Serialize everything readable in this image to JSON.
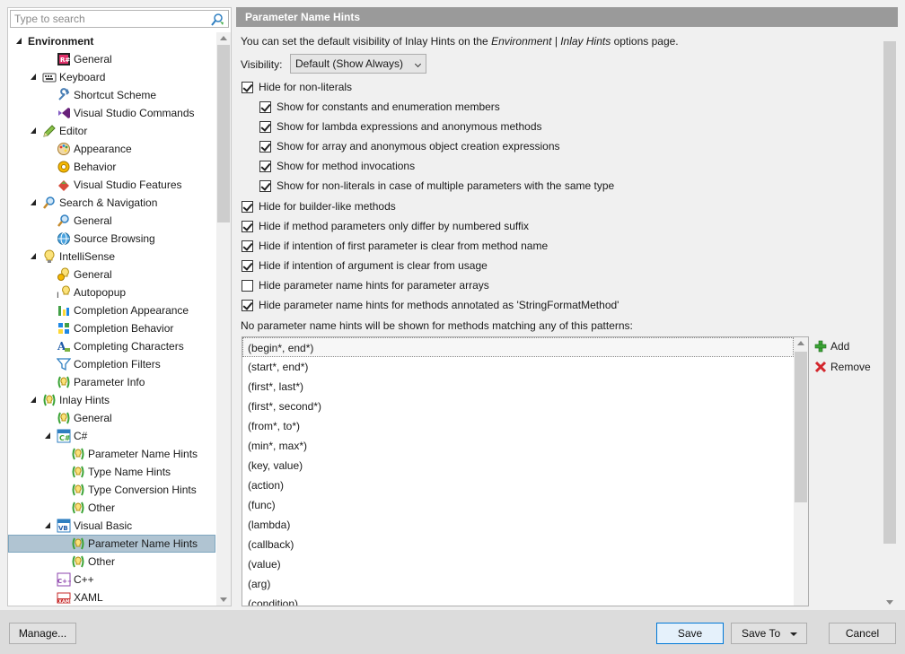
{
  "search": {
    "placeholder": "Type to search"
  },
  "tree": [
    {
      "label": "Environment",
      "level": 0,
      "exp": "open",
      "bold": true,
      "icon": "none"
    },
    {
      "label": "General",
      "level": 2,
      "exp": "none",
      "icon": "resharper"
    },
    {
      "label": "Keyboard",
      "level": 1,
      "exp": "open",
      "icon": "keyboard"
    },
    {
      "label": "Shortcut Scheme",
      "level": 2,
      "exp": "none",
      "icon": "wrench"
    },
    {
      "label": "Visual Studio Commands",
      "level": 2,
      "exp": "none",
      "icon": "vs"
    },
    {
      "label": "Editor",
      "level": 1,
      "exp": "open",
      "icon": "pencil"
    },
    {
      "label": "Appearance",
      "level": 2,
      "exp": "none",
      "icon": "palette"
    },
    {
      "label": "Behavior",
      "level": 2,
      "exp": "none",
      "icon": "gear"
    },
    {
      "label": "Visual Studio Features",
      "level": 2,
      "exp": "none",
      "icon": "puzzle"
    },
    {
      "label": "Search & Navigation",
      "level": 1,
      "exp": "open",
      "icon": "magnifier"
    },
    {
      "label": "General",
      "level": 2,
      "exp": "none",
      "icon": "magnifier"
    },
    {
      "label": "Source Browsing",
      "level": 2,
      "exp": "none",
      "icon": "globe"
    },
    {
      "label": "IntelliSense",
      "level": 1,
      "exp": "open",
      "icon": "bulb"
    },
    {
      "label": "General",
      "level": 2,
      "exp": "none",
      "icon": "bulb-gear"
    },
    {
      "label": "Autopopup",
      "level": 2,
      "exp": "none",
      "icon": "bulb-text"
    },
    {
      "label": "Completion Appearance",
      "level": 2,
      "exp": "none",
      "icon": "completion"
    },
    {
      "label": "Completion Behavior",
      "level": 2,
      "exp": "none",
      "icon": "completion-grid"
    },
    {
      "label": "Completing Characters",
      "level": 2,
      "exp": "none",
      "icon": "font"
    },
    {
      "label": "Completion Filters",
      "level": 2,
      "exp": "none",
      "icon": "filter"
    },
    {
      "label": "Parameter Info",
      "level": 2,
      "exp": "none",
      "icon": "param"
    },
    {
      "label": "Inlay Hints",
      "level": 1,
      "exp": "open",
      "icon": "param"
    },
    {
      "label": "General",
      "level": 2,
      "exp": "none",
      "icon": "param"
    },
    {
      "label": "C#",
      "level": 2,
      "exp": "open",
      "icon": "csharp"
    },
    {
      "label": "Parameter Name Hints",
      "level": 3,
      "exp": "none",
      "icon": "param"
    },
    {
      "label": "Type Name Hints",
      "level": 3,
      "exp": "none",
      "icon": "param"
    },
    {
      "label": "Type Conversion Hints",
      "level": 3,
      "exp": "none",
      "icon": "param"
    },
    {
      "label": "Other",
      "level": 3,
      "exp": "none",
      "icon": "param"
    },
    {
      "label": "Visual Basic",
      "level": 2,
      "exp": "open",
      "icon": "vb"
    },
    {
      "label": "Parameter Name Hints",
      "level": 3,
      "exp": "none",
      "icon": "param",
      "selected": true
    },
    {
      "label": "Other",
      "level": 3,
      "exp": "none",
      "icon": "param"
    },
    {
      "label": "C++",
      "level": 2,
      "exp": "closed",
      "icon": "cpp"
    },
    {
      "label": "XAML",
      "level": 2,
      "exp": "none",
      "icon": "xaml"
    }
  ],
  "page": {
    "title": "Parameter Name Hints",
    "intro_prefix": "You can set the default visibility of Inlay Hints on the ",
    "intro_link": "Environment | Inlay Hints",
    "intro_suffix": " options page.",
    "visibility_label": "Visibility:",
    "visibility_value": "Default (Show Always)",
    "patterns_label": "No parameter name hints will be shown for methods matching any of this patterns:"
  },
  "options": [
    {
      "label": "Hide for non-literals",
      "checked": true,
      "indent": 0
    },
    {
      "label": "Show for constants and enumeration members",
      "checked": true,
      "indent": 1
    },
    {
      "label": "Show for lambda expressions and anonymous methods",
      "checked": true,
      "indent": 1
    },
    {
      "label": "Show for array and anonymous object creation expressions",
      "checked": true,
      "indent": 1
    },
    {
      "label": "Show for method invocations",
      "checked": true,
      "indent": 1
    },
    {
      "label": "Show for non-literals in case of multiple parameters with the same type",
      "checked": true,
      "indent": 1
    },
    {
      "label": "Hide for builder-like methods",
      "checked": true,
      "indent": 0
    },
    {
      "label": "Hide if method parameters only differ by numbered suffix",
      "checked": true,
      "indent": 0
    },
    {
      "label": "Hide if intention of first parameter is clear from method name",
      "checked": true,
      "indent": 0
    },
    {
      "label": "Hide if intention of argument is clear from usage",
      "checked": true,
      "indent": 0
    },
    {
      "label": "Hide parameter name hints for parameter arrays",
      "checked": false,
      "indent": 0
    },
    {
      "label": "Hide parameter name hints for methods annotated as 'StringFormatMethod'",
      "checked": true,
      "indent": 0
    }
  ],
  "patterns": [
    "(begin*, end*)",
    "(start*, end*)",
    "(first*, last*)",
    "(first*, second*)",
    "(from*, to*)",
    "(min*, max*)",
    "(key, value)",
    "(action)",
    "(func)",
    "(lambda)",
    "(callback)",
    "(value)",
    "(arg)",
    "(condition)"
  ],
  "side": {
    "add": "Add",
    "remove": "Remove"
  },
  "buttons": {
    "manage": "Manage...",
    "save": "Save",
    "save_to": "Save To",
    "cancel": "Cancel"
  },
  "colors": {
    "titlebar": "#9a9a9a",
    "selected": "#b0c4d2",
    "default_border": "#0078d7"
  }
}
